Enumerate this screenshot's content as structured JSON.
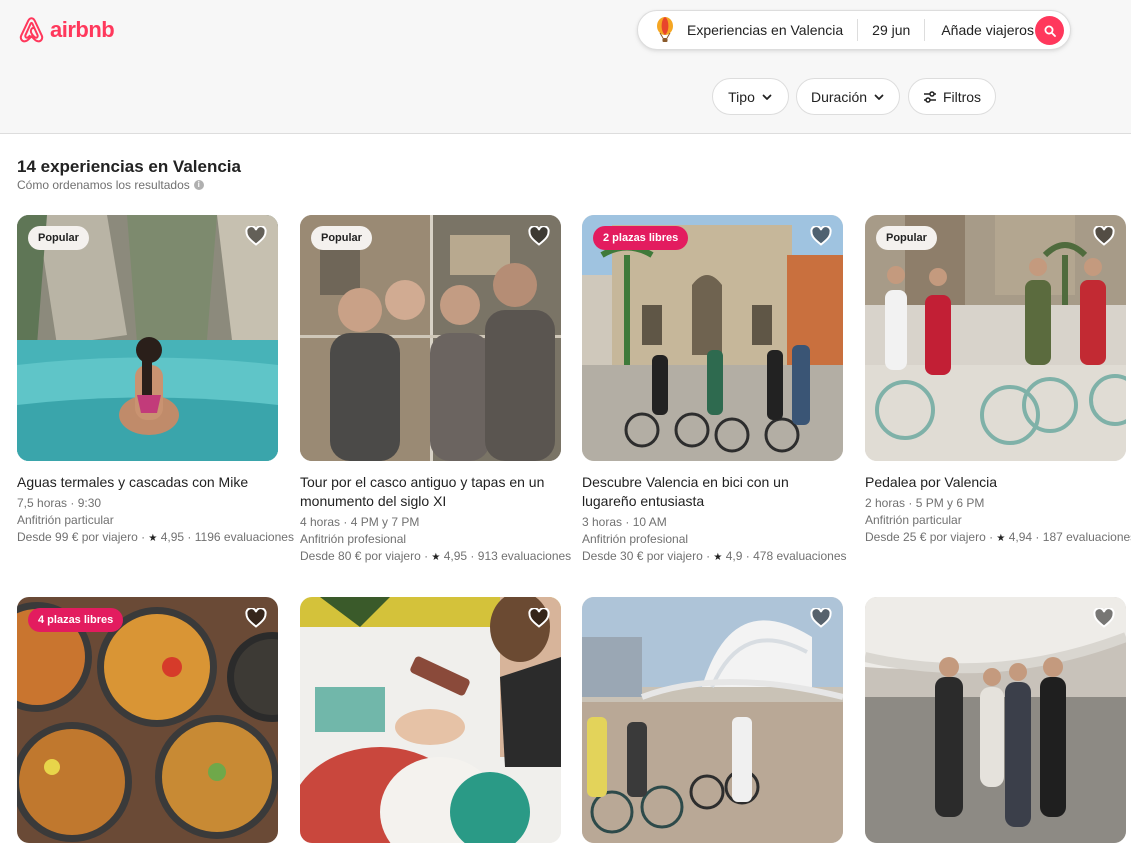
{
  "brand": {
    "name": "airbnb",
    "color": "#ff385c"
  },
  "search": {
    "location": "Experiencias en Valencia",
    "date": "29 jun",
    "guests": "Añade viajeros"
  },
  "filters": [
    {
      "label": "Tipo",
      "icon": "chevron-down-icon"
    },
    {
      "label": "Duración",
      "icon": "chevron-down-icon"
    },
    {
      "label": "Filtros",
      "icon": "sliders-icon"
    }
  ],
  "results": {
    "title": "14 experiencias en Valencia",
    "subtitle": "Cómo ordenamos los resultados"
  },
  "cards": [
    {
      "badge": "Popular",
      "title": "Aguas termales y cascadas con Mike",
      "meta": "7,5 horas · 9:30",
      "host": "Anfitrión particular",
      "price": "Desde 99 € por viajero ·",
      "rating": "4,95",
      "reviews": "1196 evaluaciones"
    },
    {
      "badge": "Popular",
      "title": "Tour por el casco antiguo y tapas en un monumento del siglo XI",
      "meta": "4 horas · 4 PM y 7 PM",
      "host": "Anfitrión profesional",
      "price": "Desde 80 € por viajero ·",
      "rating": "4,95",
      "reviews": "913 evaluaciones"
    },
    {
      "badge": "2 plazas libres",
      "title": "Descubre Valencia en bici con un lugareño entusiasta",
      "meta": "3 horas · 10 AM",
      "host": "Anfitrión profesional",
      "price": "Desde 30 € por viajero ·",
      "rating": "4,9",
      "reviews": "478 evaluaciones"
    },
    {
      "badge": "Popular",
      "title": "Pedalea por Valencia",
      "meta": "2 horas · 5 PM y 6 PM",
      "host": "Anfitrión particular",
      "price": "Desde 25 € por viajero ·",
      "rating": "4,94",
      "reviews": "187 evaluaciones"
    },
    {
      "badge": "4 plazas libres"
    },
    {},
    {},
    {}
  ]
}
